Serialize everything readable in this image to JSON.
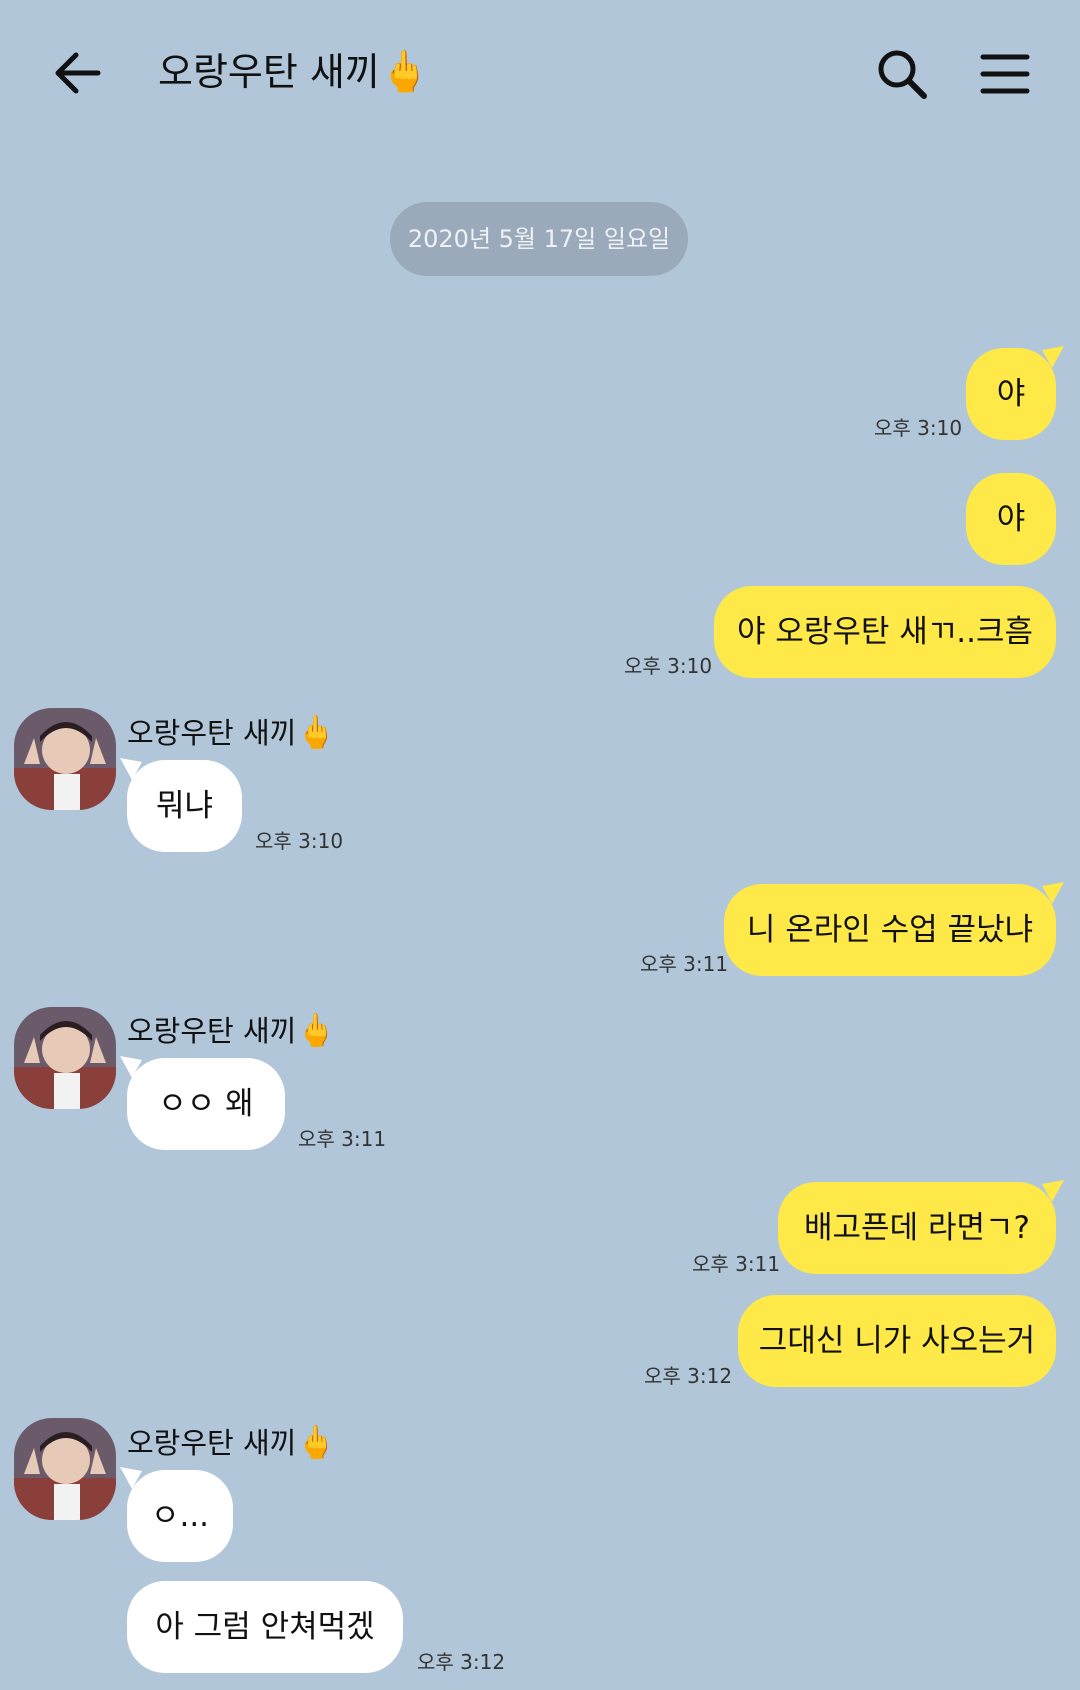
{
  "header": {
    "title": "오랑우탄 새끼",
    "title_emoji": "🖕",
    "back_icon": "arrow-left-icon",
    "search_icon": "search-icon",
    "menu_icon": "hamburger-menu-icon"
  },
  "date_divider": "2020년 5월 17일 일요일",
  "colors": {
    "background": "#b1c6d9",
    "my_bubble": "#fee949",
    "their_bubble": "#ffffff",
    "date_pill": "#9aaabb"
  },
  "contact": {
    "name": "오랑우탄 새끼",
    "emoji": "🖕"
  },
  "messages": [
    {
      "from": "me",
      "text": "야",
      "time": "오후 3:10"
    },
    {
      "from": "me",
      "text": "야",
      "time": ""
    },
    {
      "from": "me",
      "text": "야 오랑우탄 새ㄲ..크흠",
      "time": "오후 3:10"
    },
    {
      "from": "them",
      "text": "뭐냐",
      "time": "오후 3:10"
    },
    {
      "from": "me",
      "text": "니 온라인 수업 끝났냐",
      "time": "오후 3:11"
    },
    {
      "from": "them",
      "text": "ㅇㅇ 왜",
      "time": "오후 3:11"
    },
    {
      "from": "me",
      "text": "배고픈데 라면ㄱ?",
      "time": "오후 3:11"
    },
    {
      "from": "me",
      "text": "그대신 니가 사오는거",
      "time": "오후 3:12"
    },
    {
      "from": "them",
      "text": "ㅇ...",
      "time": ""
    },
    {
      "from": "them",
      "text": "아 그럼 안쳐먹겠",
      "time": "오후 3:12"
    }
  ]
}
